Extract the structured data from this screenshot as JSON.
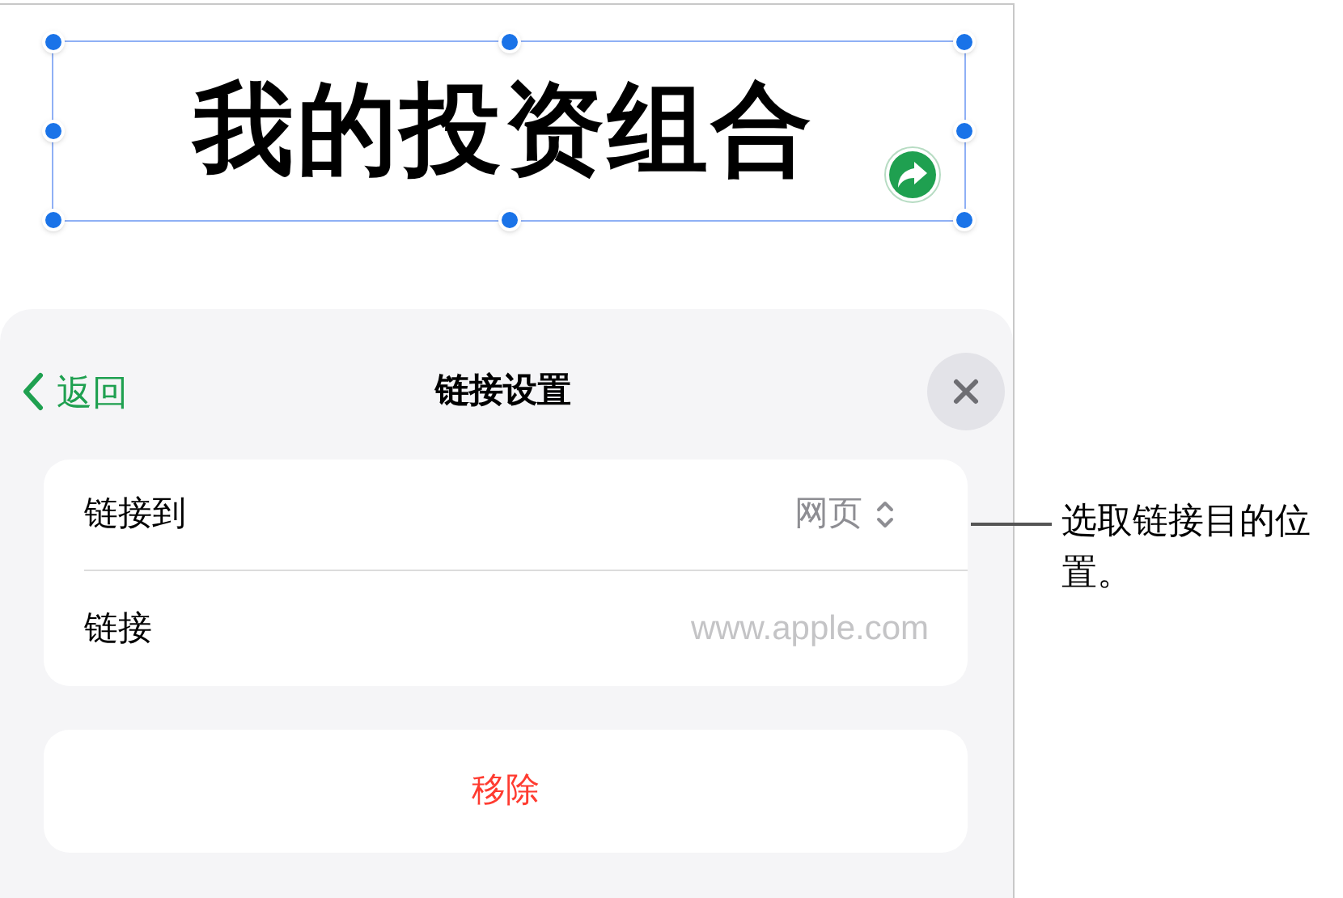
{
  "document": {
    "title": "我的投资组合"
  },
  "sheet": {
    "back": "返回",
    "title": "链接设置",
    "link_to": {
      "label": "链接到",
      "value": "网页"
    },
    "link": {
      "label": "链接",
      "placeholder": "www.apple.com"
    },
    "remove": "移除"
  },
  "callout": "选取链接目的位置。"
}
